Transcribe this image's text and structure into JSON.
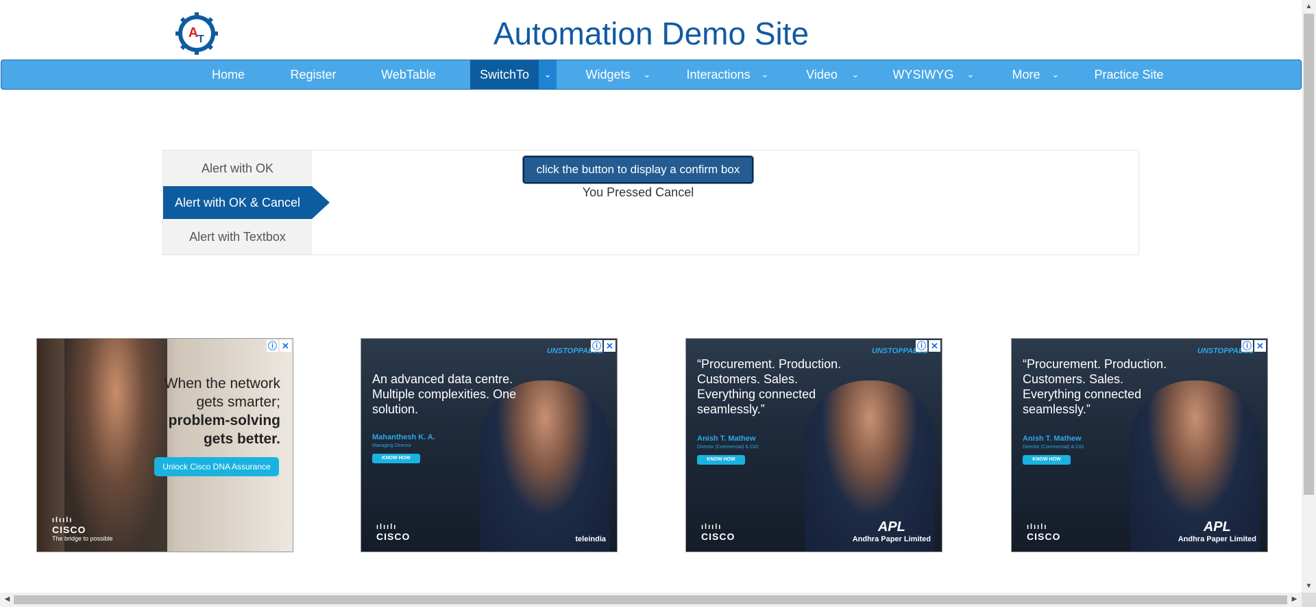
{
  "header": {
    "title": "Automation Demo Site",
    "logo_letters": "AT"
  },
  "nav": {
    "items": [
      {
        "label": "Home"
      },
      {
        "label": "Register"
      },
      {
        "label": "WebTable"
      },
      {
        "label": "SwitchTo",
        "active": true
      },
      {
        "label": "Widgets"
      },
      {
        "label": "Interactions"
      },
      {
        "label": "Video"
      },
      {
        "label": "WYSIWYG"
      },
      {
        "label": "More"
      },
      {
        "label": "Practice Site"
      }
    ],
    "caret": "⌄"
  },
  "alerts": {
    "tabs": [
      {
        "label": "Alert with OK"
      },
      {
        "label": "Alert with OK & Cancel",
        "active": true
      },
      {
        "label": "Alert with Textbox"
      }
    ],
    "button_label": "click the button to display a confirm box",
    "result": "You Pressed Cancel"
  },
  "ads": {
    "close_icons": {
      "info": "ⓘ",
      "close": "✕"
    },
    "ad1": {
      "line1": "When the network",
      "line2": "gets smarter;",
      "line3": "problem-solving",
      "line4": "gets better.",
      "cta": "Unlock Cisco DNA Assurance",
      "brand": "CISCO",
      "tagline": "The bridge to possible"
    },
    "ad2": {
      "brand": "UNSTOPPABLE",
      "quote": "An advanced data centre. Multiple complexities. One solution.",
      "name": "Mahanthesh K. A.",
      "role": "Managing Director",
      "cta": "KNOW HOW",
      "cisco": "CISCO",
      "partner": "teleindia"
    },
    "ad3": {
      "brand": "UNSTOPPABLE",
      "quote": "“Procurement. Production. Customers. Sales. Everything connected seamlessly.”",
      "name": "Anish T. Mathew",
      "role": "Director (Commercial) & CIO",
      "cta": "KNOW HOW",
      "cisco": "CISCO",
      "partner_mark": "APL",
      "partner": "Andhra Paper Limited"
    },
    "ad4": {
      "brand": "UNSTOPPABLE",
      "quote": "“Procurement. Production. Customers. Sales. Everything connected seamlessly.”",
      "name": "Anish T. Mathew",
      "role": "Director (Commercial) & CIO",
      "cta": "KNOW HOW",
      "cisco": "CISCO",
      "partner_mark": "APL",
      "partner": "Andhra Paper Limited"
    }
  },
  "colors": {
    "nav_bg": "#4aa8e8",
    "nav_active": "#0d5ca0",
    "title": "#0f5aa3",
    "button": "#245c91"
  }
}
